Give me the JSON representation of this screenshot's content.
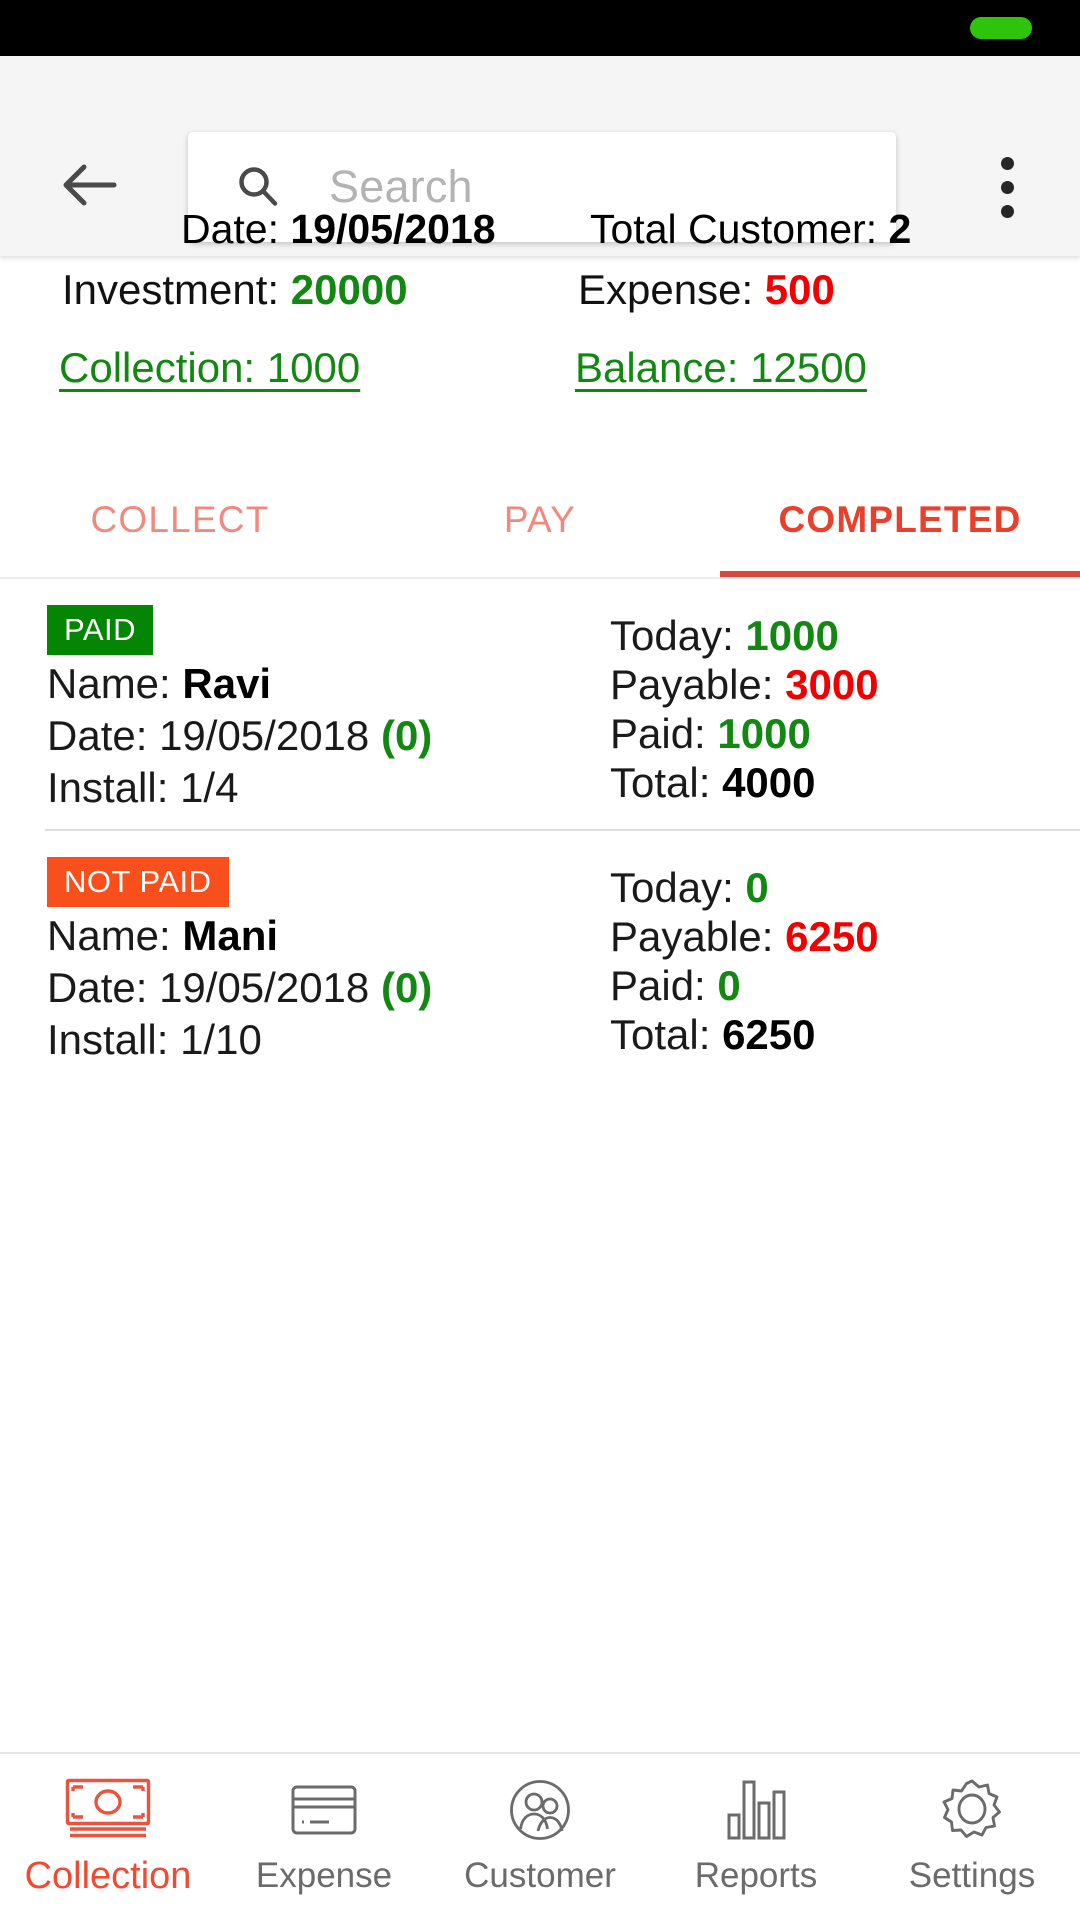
{
  "status_bar": {
    "battery_icon": "battery-full-icon",
    "battery_color": "#2ec40c"
  },
  "app_bar": {
    "back_icon": "back-arrow-icon",
    "overflow_icon": "more-vertical-icon",
    "search": {
      "icon": "search-icon",
      "placeholder": "Search",
      "value": ""
    },
    "date_label": "Date: ",
    "date_value": "19/05/2018",
    "total_customer_label": "Total Customer: ",
    "total_customer_value": "2"
  },
  "summary": {
    "investment_label": "Investment: ",
    "investment_value": "20000",
    "expense_label": "Expense: ",
    "expense_value": "500",
    "collection_link": "Collection: 1000",
    "balance_link": "Balance: 12500",
    "colors": {
      "green": "#128712",
      "red": "#f20000"
    }
  },
  "tabs": {
    "items": [
      {
        "label": "COLLECT",
        "active": false
      },
      {
        "label": "PAY",
        "active": false
      },
      {
        "label": "COMPLETED",
        "active": true
      }
    ],
    "active_color": "#e8402b",
    "inactive_color": "#f08a7e",
    "indicator_color": "#d9483a"
  },
  "list": {
    "rows": [
      {
        "badge": "PAID",
        "badge_color": "#048504",
        "name_label": "Name: ",
        "name_value": "Ravi",
        "date_label": "Date: ",
        "date_value": "19/05/2018",
        "date_paren": "(0)",
        "install_label": "Install: ",
        "install_value": "1/4",
        "today_label": "Today: ",
        "today_value": "1000",
        "payable_label": "Payable: ",
        "payable_value": "3000",
        "paid_label": "Paid: ",
        "paid_value": "1000",
        "total_label": "Total: ",
        "total_value": "4000"
      },
      {
        "badge": "NOT PAID",
        "badge_color": "#f94f1c",
        "name_label": "Name: ",
        "name_value": "Mani",
        "date_label": "Date: ",
        "date_value": "19/05/2018",
        "date_paren": "(0)",
        "install_label": "Install: ",
        "install_value": "1/10",
        "today_label": "Today: ",
        "today_value": "0",
        "payable_label": "Payable: ",
        "payable_value": "6250",
        "paid_label": "Paid: ",
        "paid_value": "0",
        "total_label": "Total: ",
        "total_value": "6250"
      }
    ]
  },
  "bottom_nav": {
    "items": [
      {
        "label": "Collection",
        "icon": "banknote-icon",
        "active": true
      },
      {
        "label": "Expense",
        "icon": "credit-card-icon",
        "active": false
      },
      {
        "label": "Customer",
        "icon": "people-circle-icon",
        "active": false
      },
      {
        "label": "Reports",
        "icon": "bar-chart-icon",
        "active": false
      },
      {
        "label": "Settings",
        "icon": "gear-icon",
        "active": false
      }
    ],
    "active_color": "#f04a33",
    "inactive_color": "#6b6b6b"
  }
}
